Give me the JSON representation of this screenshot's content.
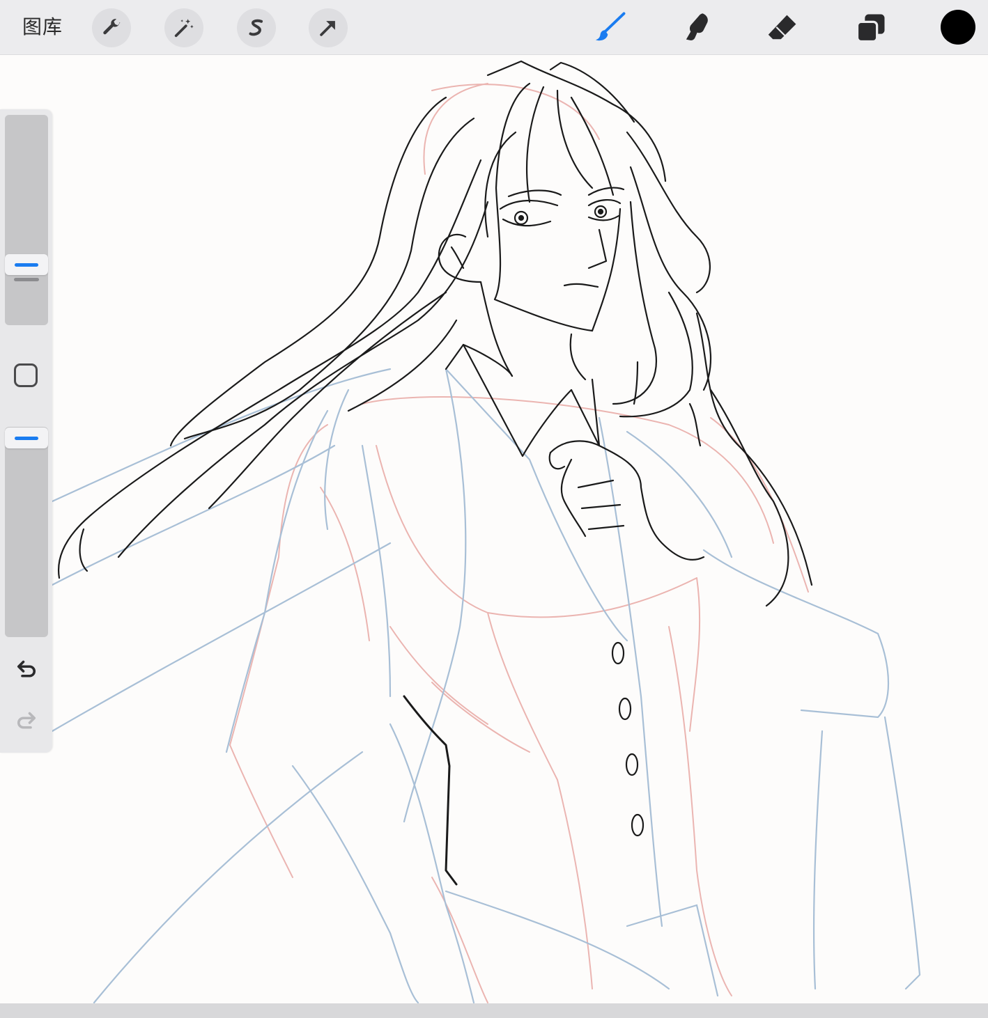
{
  "app": {
    "gallery_label": "图库"
  },
  "toolbar": {
    "left_tools": [
      {
        "name": "actions",
        "icon": "wrench-icon"
      },
      {
        "name": "adjustments",
        "icon": "magic-wand-icon"
      },
      {
        "name": "selection",
        "icon": "selection-s-icon"
      },
      {
        "name": "transform",
        "icon": "arrow-cursor-icon"
      }
    ],
    "right_tools": [
      {
        "name": "brush",
        "icon": "brush-icon",
        "active": true
      },
      {
        "name": "smudge",
        "icon": "smudge-icon"
      },
      {
        "name": "eraser",
        "icon": "eraser-icon"
      },
      {
        "name": "layers",
        "icon": "layers-icon"
      }
    ],
    "current_color": "#000000",
    "active_color": "#1a7cf0"
  },
  "sidebar": {
    "brush_size_level": 0.72,
    "opacity_level": 1.0,
    "modifier_icon": "square-modifier-icon",
    "undo_icon": "undo-icon",
    "redo_icon": "redo-icon"
  },
  "canvas": {
    "content": "line-art-sketch"
  }
}
